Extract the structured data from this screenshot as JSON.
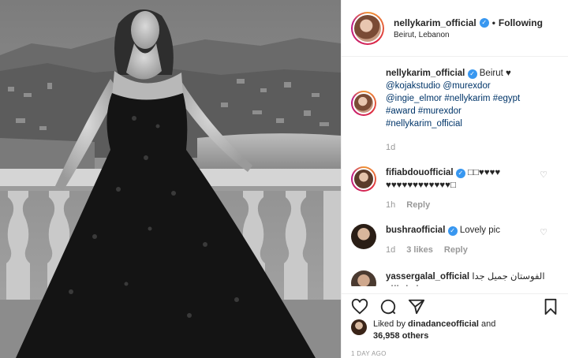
{
  "header": {
    "username": "nellykarim_official",
    "separator": "•",
    "follow_label": "Following",
    "location": "Beirut, Lebanon"
  },
  "caption": {
    "username": "nellykarim_official",
    "text": "Beirut ♥",
    "tags": [
      "@kojakstudio",
      "@murexdor",
      "@ingie_elmor",
      "#nellykarim",
      "#egypt",
      "#award",
      "#murexdor",
      "#nellykarim_official"
    ],
    "time": "1d"
  },
  "comments": [
    {
      "username": "fifiabdouofficial",
      "text": "□□♥♥♥♥ ♥♥♥♥♥♥♥♥♥♥♥♥□",
      "time": "1h",
      "reply_label": "Reply"
    },
    {
      "username": "bushraofficial",
      "text": "Lovely pic",
      "time": "1d",
      "likes": "3 likes",
      "reply_label": "Reply"
    },
    {
      "username": "yassergalal_official",
      "text": "الفوستان جميل جدا ♥□□ماشاء الله"
    }
  ],
  "likes": {
    "prefix": "Liked by",
    "user": "dinadanceofficial",
    "and": "and",
    "count": "36,958 others"
  },
  "posted": "1 DAY AGO",
  "icons": {
    "like": "heart-icon",
    "comment": "comment-icon",
    "share": "share-icon",
    "save": "bookmark-icon"
  },
  "colors": {
    "verified": "#3897f0",
    "tag": "#003569",
    "muted": "#999999"
  }
}
